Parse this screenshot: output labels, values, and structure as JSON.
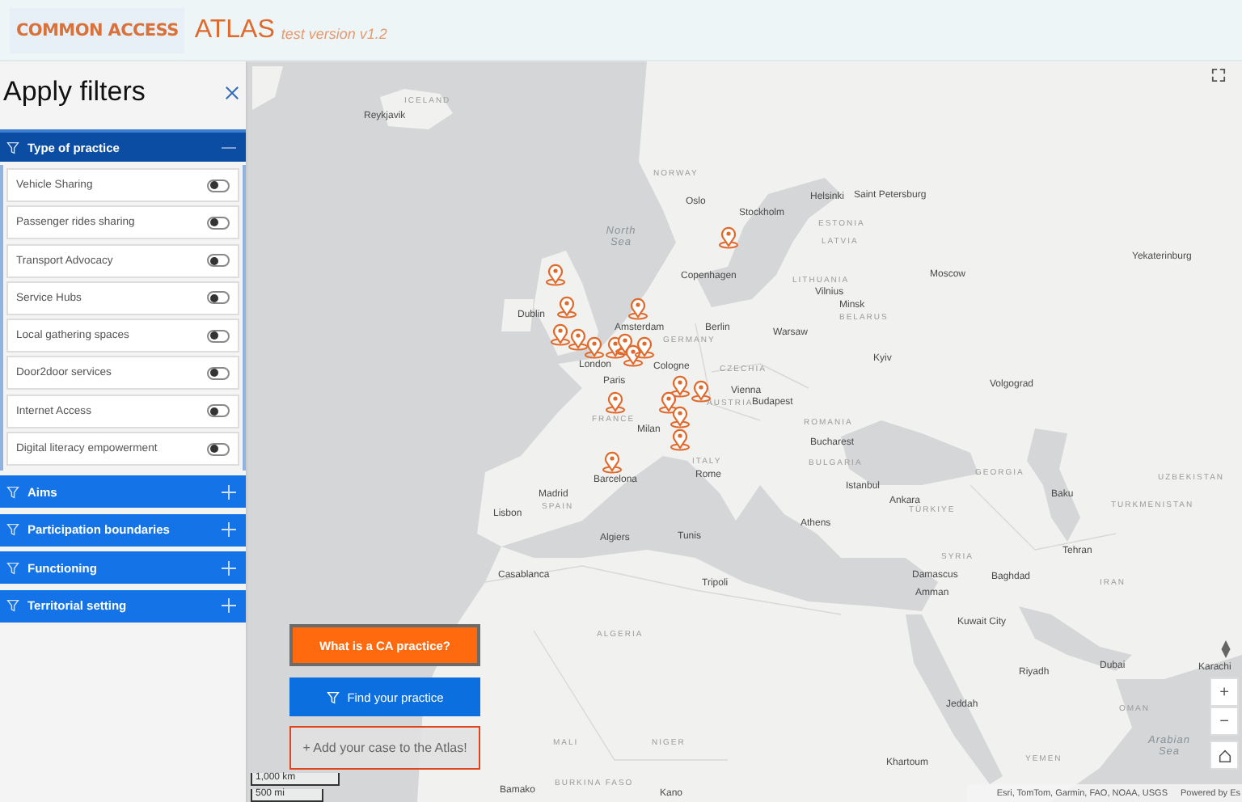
{
  "header": {
    "logo": "COMMON ACCESS",
    "title": "ATLAS",
    "subtitle": "test version v1.2"
  },
  "sidebar": {
    "title": "Apply filters",
    "filters": [
      {
        "label": "Type of practice",
        "expanded": true,
        "options": [
          {
            "label": "Vehicle Sharing",
            "on": false
          },
          {
            "label": "Passenger rides sharing",
            "on": false
          },
          {
            "label": "Transport Advocacy",
            "on": false
          },
          {
            "label": "Service Hubs",
            "on": false
          },
          {
            "label": "Local gathering spaces",
            "on": false
          },
          {
            "label": "Door2door services",
            "on": false
          },
          {
            "label": "Internet Access",
            "on": false
          },
          {
            "label": "Digital literacy empowerment",
            "on": false
          }
        ]
      },
      {
        "label": "Aims",
        "expanded": false
      },
      {
        "label": "Participation boundaries",
        "expanded": false
      },
      {
        "label": "Functioning",
        "expanded": false
      },
      {
        "label": "Territorial setting",
        "expanded": false
      }
    ]
  },
  "map": {
    "labels": [
      {
        "text": "ICELAND",
        "kind": "country"
      },
      {
        "text": "Reykjavik",
        "kind": "city"
      },
      {
        "text": "NORWAY",
        "kind": "country"
      },
      {
        "text": "Oslo",
        "kind": "city"
      },
      {
        "text": "Stockholm",
        "kind": "city"
      },
      {
        "text": "Helsinki",
        "kind": "city"
      },
      {
        "text": "Saint Petersburg",
        "kind": "city"
      },
      {
        "text": "ESTONIA",
        "kind": "country"
      },
      {
        "text": "LATVIA",
        "kind": "country"
      },
      {
        "text": "North Sea",
        "kind": "sea"
      },
      {
        "text": "Dublin",
        "kind": "city"
      },
      {
        "text": "Copenhagen",
        "kind": "city"
      },
      {
        "text": "LITHUANIA",
        "kind": "country"
      },
      {
        "text": "Vilnius",
        "kind": "city"
      },
      {
        "text": "Minsk",
        "kind": "city"
      },
      {
        "text": "BELARUS",
        "kind": "country"
      },
      {
        "text": "Berlin",
        "kind": "city"
      },
      {
        "text": "Warsaw",
        "kind": "city"
      },
      {
        "text": "GERMANY",
        "kind": "country"
      },
      {
        "text": "Amsterdam",
        "kind": "city"
      },
      {
        "text": "London",
        "kind": "city"
      },
      {
        "text": "Cologne",
        "kind": "city"
      },
      {
        "text": "Paris",
        "kind": "city"
      },
      {
        "text": "CZECHIA",
        "kind": "country"
      },
      {
        "text": "Kyiv",
        "kind": "city"
      },
      {
        "text": "Vienna",
        "kind": "city"
      },
      {
        "text": "Budapest",
        "kind": "city"
      },
      {
        "text": "AUSTRIA",
        "kind": "country"
      },
      {
        "text": "FRANCE",
        "kind": "country"
      },
      {
        "text": "Milan",
        "kind": "city"
      },
      {
        "text": "ROMANIA",
        "kind": "country"
      },
      {
        "text": "Bucharest",
        "kind": "city"
      },
      {
        "text": "BULGARIA",
        "kind": "country"
      },
      {
        "text": "ITALY",
        "kind": "country"
      },
      {
        "text": "Rome",
        "kind": "city"
      },
      {
        "text": "Barcelona",
        "kind": "city"
      },
      {
        "text": "Madrid",
        "kind": "city"
      },
      {
        "text": "Istanbul",
        "kind": "city"
      },
      {
        "text": "SPAIN",
        "kind": "country"
      },
      {
        "text": "Lisbon",
        "kind": "city"
      },
      {
        "text": "Algiers",
        "kind": "city"
      },
      {
        "text": "Tunis",
        "kind": "city"
      },
      {
        "text": "Athens",
        "kind": "city"
      },
      {
        "text": "Ankara",
        "kind": "city"
      },
      {
        "text": "TÜRKIYE",
        "kind": "country"
      },
      {
        "text": "GEORGIA",
        "kind": "country"
      },
      {
        "text": "Baku",
        "kind": "city"
      },
      {
        "text": "TURKMENISTAN",
        "kind": "country"
      },
      {
        "text": "UZBEKISTAN",
        "kind": "country"
      },
      {
        "text": "Moscow",
        "kind": "city"
      },
      {
        "text": "Yekaterinburg",
        "kind": "city"
      },
      {
        "text": "Volgograd",
        "kind": "city"
      },
      {
        "text": "Tehran",
        "kind": "city"
      },
      {
        "text": "IRAN",
        "kind": "country"
      },
      {
        "text": "SYRIA",
        "kind": "country"
      },
      {
        "text": "Damascus",
        "kind": "city"
      },
      {
        "text": "Baghdad",
        "kind": "city"
      },
      {
        "text": "Amman",
        "kind": "city"
      },
      {
        "text": "Tripoli",
        "kind": "city"
      },
      {
        "text": "Casablanca",
        "kind": "city"
      },
      {
        "text": "Kuwait City",
        "kind": "city"
      },
      {
        "text": "Riyadh",
        "kind": "city"
      },
      {
        "text": "Dubai",
        "kind": "city"
      },
      {
        "text": "Jeddah",
        "kind": "city"
      },
      {
        "text": "OMAN",
        "kind": "country"
      },
      {
        "text": "YEMEN",
        "kind": "country"
      },
      {
        "text": "Arabian Sea",
        "kind": "sea"
      },
      {
        "text": "Karachi",
        "kind": "city"
      },
      {
        "text": "ALGERIA",
        "kind": "country"
      },
      {
        "text": "MALI",
        "kind": "country"
      },
      {
        "text": "NIGER",
        "kind": "country"
      },
      {
        "text": "BURKINA FASO",
        "kind": "country"
      },
      {
        "text": "Bamako",
        "kind": "city"
      },
      {
        "text": "Kano",
        "kind": "city"
      },
      {
        "text": "Khartoum",
        "kind": "city"
      }
    ],
    "buttons": [
      {
        "label": "What is a CA practice?",
        "kind": "info"
      },
      {
        "label": "Find your practice",
        "kind": "filter"
      },
      {
        "label": "+ Add your case to the Atlas!",
        "kind": "add"
      }
    ],
    "zoom_in": "+",
    "zoom_out": "−",
    "scale": [
      "1,000 km",
      "500 mi"
    ],
    "attribution": "Esri, TomTom, Garmin, FAO, NOAA, USGS",
    "powered": "Powered by Es"
  }
}
